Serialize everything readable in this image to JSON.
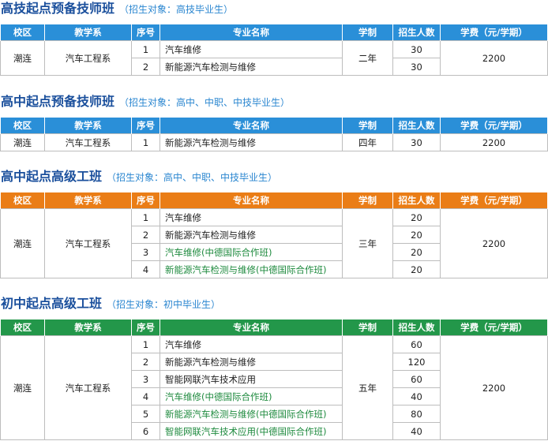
{
  "columns": [
    "校区",
    "教学系",
    "序号",
    "专业名称",
    "学制",
    "招生人数",
    "学费（元/学期）"
  ],
  "sections": [
    {
      "title": "高技起点预备技师班",
      "subtitle": "（招生对象：高技毕业生）",
      "header_color": "#2a8fd8",
      "campus": "潮连",
      "department": "汽车工程系",
      "duration": "二年",
      "fee": "2200",
      "rows": [
        {
          "no": "1",
          "name": "汽车维修",
          "count": "30"
        },
        {
          "no": "2",
          "name": "新能源汽车检测与维修",
          "count": "30"
        }
      ]
    },
    {
      "title": "高中起点预备技师班",
      "subtitle": "（招生对象：高中、中职、中技毕业生）",
      "header_color": "#2a8fd8",
      "campus": "潮连",
      "department": "汽车工程系",
      "duration": "四年",
      "fee": "2200",
      "rows": [
        {
          "no": "1",
          "name": "新能源汽车检测与维修",
          "count": "30"
        }
      ]
    },
    {
      "title": "高中起点高级工班",
      "subtitle": "（招生对象：高中、中职、中技毕业生）",
      "header_color": "#ea7d16",
      "campus": "潮连",
      "department": "汽车工程系",
      "duration": "三年",
      "fee": "2200",
      "rows": [
        {
          "no": "1",
          "name": "汽车维修",
          "count": "20"
        },
        {
          "no": "2",
          "name": "新能源汽车检测与维修",
          "count": "20"
        },
        {
          "no": "3",
          "name": "汽车维修(中德国际合作班)",
          "count": "20"
        },
        {
          "no": "4",
          "name": "新能源汽车检测与维修(中德国际合作班)",
          "count": "20"
        }
      ]
    },
    {
      "title": "初中起点高级工班",
      "subtitle": "（招生对象：初中毕业生）",
      "header_color": "#23974a",
      "campus": "潮连",
      "department": "汽车工程系",
      "duration": "五年",
      "fee": "2200",
      "rows": [
        {
          "no": "1",
          "name": "汽车维修",
          "count": "60"
        },
        {
          "no": "2",
          "name": "新能源汽车检测与维修",
          "count": "120"
        },
        {
          "no": "3",
          "name": "智能网联汽车技术应用",
          "count": "60"
        },
        {
          "no": "4",
          "name": "汽车维修(中德国际合作班)",
          "count": "40"
        },
        {
          "no": "5",
          "name": "新能源汽车检测与维修(中德国际合作班)",
          "count": "80"
        },
        {
          "no": "6",
          "name": "智能网联汽车技术应用(中德国际合作班)",
          "count": "40"
        }
      ]
    }
  ]
}
